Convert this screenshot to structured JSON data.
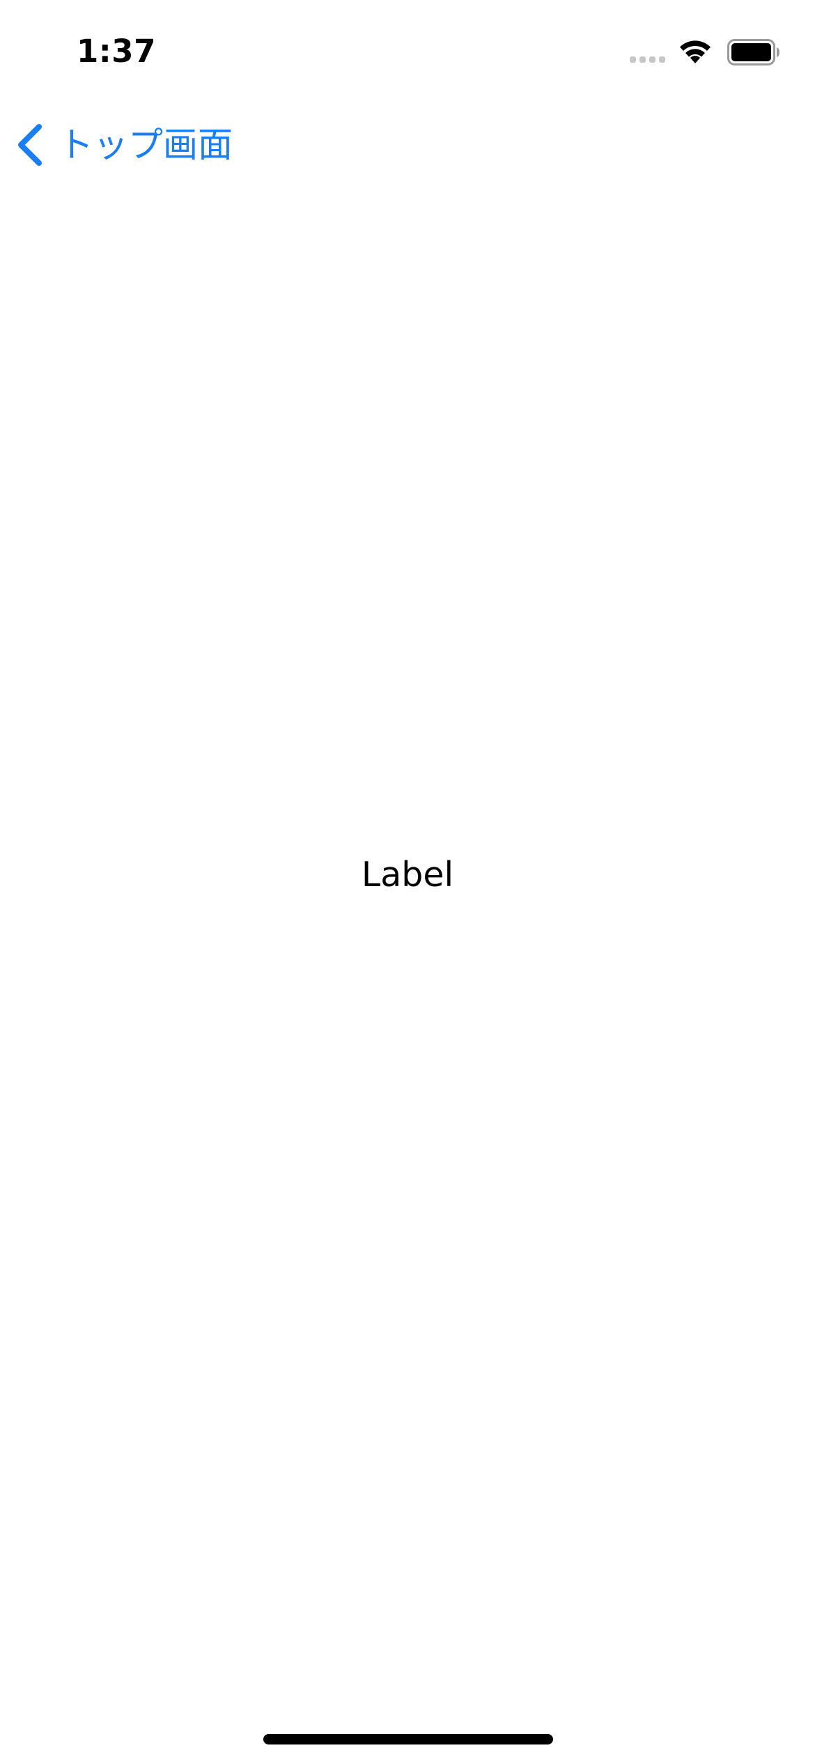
{
  "status_bar": {
    "time": "1:37",
    "icons": [
      "signal-icon",
      "wifi-icon",
      "battery-icon"
    ]
  },
  "nav_bar": {
    "back_label": "トップ画面",
    "back_icon": "chevron-left-icon"
  },
  "content": {
    "label": "Label"
  },
  "colors": {
    "accent": "#1a7ef7",
    "background": "#ffffff",
    "text": "#000000"
  }
}
